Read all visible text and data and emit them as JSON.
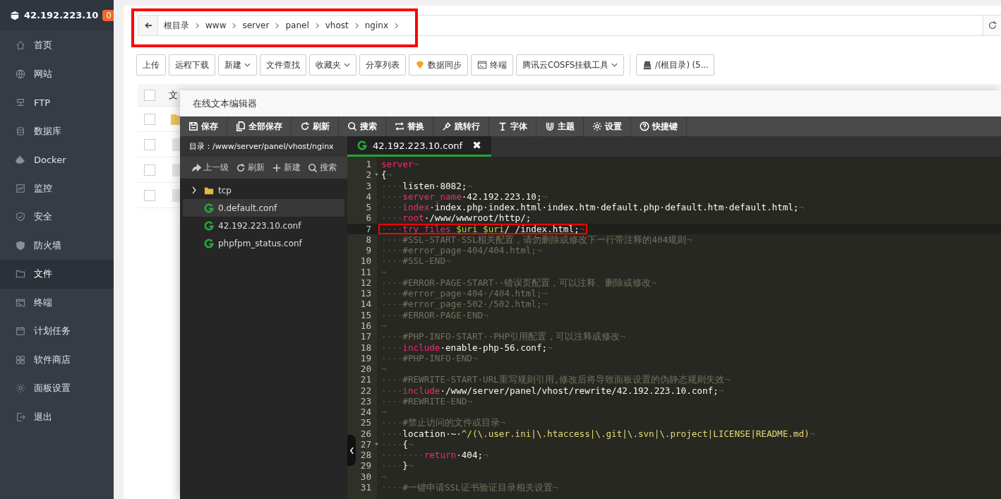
{
  "sidebar": {
    "server": "42.192.223.10",
    "badge": "0",
    "items": [
      {
        "label": "首页",
        "selected": false
      },
      {
        "label": "网站",
        "selected": false
      },
      {
        "label": "FTP",
        "selected": false
      },
      {
        "label": "数据库",
        "selected": false
      },
      {
        "label": "Docker",
        "selected": false
      },
      {
        "label": "监控",
        "selected": false
      },
      {
        "label": "安全",
        "selected": false
      },
      {
        "label": "防火墙",
        "selected": false
      },
      {
        "label": "文件",
        "selected": true
      },
      {
        "label": "终端",
        "selected": false
      },
      {
        "label": "计划任务",
        "selected": false
      },
      {
        "label": "软件商店",
        "selected": false
      },
      {
        "label": "面板设置",
        "selected": false
      },
      {
        "label": "退出",
        "selected": false
      }
    ]
  },
  "breadcrumb": {
    "highlighted": true,
    "items": [
      "根目录",
      "www",
      "server",
      "panel",
      "vhost",
      "nginx"
    ]
  },
  "toolbar": [
    {
      "label": "上传",
      "kind": "plain"
    },
    {
      "label": "远程下载",
      "kind": "plain"
    },
    {
      "label": "新建",
      "kind": "dropdown"
    },
    {
      "label": "文件查找",
      "kind": "plain"
    },
    {
      "label": "收藏夹",
      "kind": "dropdown"
    },
    {
      "label": "分享列表",
      "kind": "plain"
    },
    {
      "label": "数据同步",
      "kind": "gem"
    },
    {
      "label": "终端",
      "kind": "terminal"
    },
    {
      "label": "腾讯云COSFS挂载工具",
      "kind": "dropdown"
    },
    {
      "label": "/(根目录) (5...",
      "kind": "disk"
    }
  ],
  "file_table": {
    "header_checkbox": {
      "checked": false
    },
    "column_1": "文",
    "rows": [
      {
        "kind": "folder",
        "checked": false
      },
      {
        "kind": "file",
        "checked": false
      },
      {
        "kind": "file",
        "checked": false
      },
      {
        "kind": "file",
        "checked": false
      }
    ]
  },
  "editor": {
    "title": "在线文本编辑器",
    "toolbar": [
      "保存",
      "全部保存",
      "刷新",
      "搜索",
      "替换",
      "跳转行",
      "字体",
      "主题",
      "设置",
      "快捷键"
    ],
    "directory": "目录：/www/server/panel/vhost/nginx",
    "actions": [
      "上一级",
      "刷新",
      "新建",
      "搜索"
    ],
    "tree": [
      {
        "name": "tcp",
        "kind": "folder",
        "selected": false
      },
      {
        "name": "0.default.conf",
        "kind": "file",
        "selected": true
      },
      {
        "name": "42.192.223.10.conf",
        "kind": "file",
        "selected": false
      },
      {
        "name": "phpfpm_status.conf",
        "kind": "file",
        "selected": false
      }
    ],
    "tabs": [
      {
        "label": "42.192.223.10.conf",
        "close": "✖",
        "selected": true
      }
    ],
    "lines": [
      {
        "n": "1",
        "fold": false,
        "marked": false,
        "tokens": [
          {
            "kind": "keyword",
            "text": "server"
          },
          {
            "kind": "whitespace",
            "text": "¬"
          }
        ]
      },
      {
        "n": "2",
        "fold": true,
        "marked": false,
        "tokens": [
          {
            "kind": "plain",
            "text": "{"
          },
          {
            "kind": "whitespace",
            "text": "¬"
          }
        ]
      },
      {
        "n": "3",
        "fold": false,
        "marked": false,
        "tokens": [
          {
            "kind": "whitespace",
            "text": "····"
          },
          {
            "kind": "plain",
            "text": "listen·8082;"
          },
          {
            "kind": "whitespace",
            "text": "¬"
          }
        ]
      },
      {
        "n": "4",
        "fold": false,
        "marked": false,
        "tokens": [
          {
            "kind": "whitespace",
            "text": "····"
          },
          {
            "kind": "keyword",
            "text": "server_name"
          },
          {
            "kind": "plain",
            "text": "·42.192.223.10;"
          },
          {
            "kind": "whitespace",
            "text": "¬"
          }
        ]
      },
      {
        "n": "5",
        "fold": false,
        "marked": false,
        "tokens": [
          {
            "kind": "whitespace",
            "text": "····"
          },
          {
            "kind": "keyword",
            "text": "index"
          },
          {
            "kind": "plain",
            "text": "·index.php·index.html·index.htm·default.php·default.htm·default.html;"
          },
          {
            "kind": "whitespace",
            "text": "¬"
          }
        ]
      },
      {
        "n": "6",
        "fold": false,
        "marked": false,
        "tokens": [
          {
            "kind": "whitespace",
            "text": "····"
          },
          {
            "kind": "keyword",
            "text": "root"
          },
          {
            "kind": "plain",
            "text": "·/www/wwwroot/http/;"
          }
        ]
      },
      {
        "n": "7",
        "fold": false,
        "marked": true,
        "tokens": [
          {
            "kind": "whitespace",
            "text": "····"
          },
          {
            "kind": "keyword",
            "text": "try_files"
          },
          {
            "kind": "variable",
            "text": " $uri $uri"
          },
          {
            "kind": "plain",
            "text": "/ /index.html;"
          },
          {
            "kind": "whitespace",
            "text": "¬"
          }
        ]
      },
      {
        "n": "8",
        "fold": false,
        "marked": false,
        "tokens": [
          {
            "kind": "whitespace",
            "text": "····"
          },
          {
            "kind": "comment",
            "text": "#SSL-START·SSL相关配置，请勿删除或修改下一行带注释的404规则"
          },
          {
            "kind": "whitespace",
            "text": "¬"
          }
        ]
      },
      {
        "n": "9",
        "fold": false,
        "marked": false,
        "tokens": [
          {
            "kind": "whitespace",
            "text": "····"
          },
          {
            "kind": "comment",
            "text": "#error_page·404/404.html;"
          },
          {
            "kind": "whitespace",
            "text": "¬"
          }
        ]
      },
      {
        "n": "10",
        "fold": false,
        "marked": false,
        "tokens": [
          {
            "kind": "whitespace",
            "text": "····"
          },
          {
            "kind": "comment",
            "text": "#SSL-END"
          },
          {
            "kind": "whitespace",
            "text": "¬"
          }
        ]
      },
      {
        "n": "11",
        "fold": false,
        "marked": false,
        "tokens": [
          {
            "kind": "whitespace",
            "text": "¬"
          }
        ]
      },
      {
        "n": "12",
        "fold": false,
        "marked": false,
        "tokens": [
          {
            "kind": "whitespace",
            "text": "····"
          },
          {
            "kind": "comment",
            "text": "#ERROR-PAGE-START··错误页配置，可以注释、删除或修改"
          },
          {
            "kind": "whitespace",
            "text": "¬"
          }
        ]
      },
      {
        "n": "13",
        "fold": false,
        "marked": false,
        "tokens": [
          {
            "kind": "whitespace",
            "text": "····"
          },
          {
            "kind": "comment",
            "text": "#error_page·404·/404.html;"
          },
          {
            "kind": "whitespace",
            "text": "¬"
          }
        ]
      },
      {
        "n": "14",
        "fold": false,
        "marked": false,
        "tokens": [
          {
            "kind": "whitespace",
            "text": "····"
          },
          {
            "kind": "comment",
            "text": "#error_page·502·/502.html;"
          },
          {
            "kind": "whitespace",
            "text": "¬"
          }
        ]
      },
      {
        "n": "15",
        "fold": false,
        "marked": false,
        "tokens": [
          {
            "kind": "whitespace",
            "text": "····"
          },
          {
            "kind": "comment",
            "text": "#ERROR-PAGE-END"
          },
          {
            "kind": "whitespace",
            "text": "¬"
          }
        ]
      },
      {
        "n": "16",
        "fold": false,
        "marked": false,
        "tokens": [
          {
            "kind": "whitespace",
            "text": "¬"
          }
        ]
      },
      {
        "n": "17",
        "fold": false,
        "marked": false,
        "tokens": [
          {
            "kind": "whitespace",
            "text": "····"
          },
          {
            "kind": "comment",
            "text": "#PHP-INFO-START··PHP引用配置，可以注释或修改"
          },
          {
            "kind": "whitespace",
            "text": "¬"
          }
        ]
      },
      {
        "n": "18",
        "fold": false,
        "marked": false,
        "tokens": [
          {
            "kind": "whitespace",
            "text": "····"
          },
          {
            "kind": "keyword",
            "text": "include"
          },
          {
            "kind": "plain",
            "text": "·enable-php-56.conf;"
          },
          {
            "kind": "whitespace",
            "text": "¬"
          }
        ]
      },
      {
        "n": "19",
        "fold": false,
        "marked": false,
        "tokens": [
          {
            "kind": "whitespace",
            "text": "····"
          },
          {
            "kind": "comment",
            "text": "#PHP-INFO-END"
          },
          {
            "kind": "whitespace",
            "text": "¬"
          }
        ]
      },
      {
        "n": "20",
        "fold": false,
        "marked": false,
        "tokens": [
          {
            "kind": "whitespace",
            "text": "¬"
          }
        ]
      },
      {
        "n": "21",
        "fold": false,
        "marked": false,
        "tokens": [
          {
            "kind": "whitespace",
            "text": "····"
          },
          {
            "kind": "comment",
            "text": "#REWRITE-START·URL重写规则引用,修改后将导致面板设置的伪静态规则失效"
          },
          {
            "kind": "whitespace",
            "text": "¬"
          }
        ]
      },
      {
        "n": "22",
        "fold": false,
        "marked": false,
        "tokens": [
          {
            "kind": "whitespace",
            "text": "····"
          },
          {
            "kind": "keyword",
            "text": "include"
          },
          {
            "kind": "plain",
            "text": "·/www/server/panel/vhost/rewrite/42.192.223.10.conf;"
          },
          {
            "kind": "whitespace",
            "text": "¬"
          }
        ]
      },
      {
        "n": "23",
        "fold": false,
        "marked": false,
        "tokens": [
          {
            "kind": "whitespace",
            "text": "····"
          },
          {
            "kind": "comment",
            "text": "#REWRITE-END"
          },
          {
            "kind": "whitespace",
            "text": "¬"
          }
        ]
      },
      {
        "n": "24",
        "fold": false,
        "marked": false,
        "tokens": [
          {
            "kind": "whitespace",
            "text": "¬"
          }
        ]
      },
      {
        "n": "25",
        "fold": false,
        "marked": false,
        "tokens": [
          {
            "kind": "whitespace",
            "text": "····"
          },
          {
            "kind": "comment",
            "text": "#禁止访问的文件或目录"
          },
          {
            "kind": "whitespace",
            "text": "¬"
          }
        ]
      },
      {
        "n": "26",
        "fold": false,
        "marked": false,
        "tokens": [
          {
            "kind": "whitespace",
            "text": "····"
          },
          {
            "kind": "plain",
            "text": "location·~·"
          },
          {
            "kind": "string",
            "text": "^/(\\.user.ini|\\.htaccess|\\.git|\\.svn|\\.project|LICENSE|README.md)"
          },
          {
            "kind": "whitespace",
            "text": "¬"
          }
        ]
      },
      {
        "n": "27",
        "fold": true,
        "marked": false,
        "tokens": [
          {
            "kind": "whitespace",
            "text": "····"
          },
          {
            "kind": "plain",
            "text": "{"
          },
          {
            "kind": "whitespace",
            "text": "¬"
          }
        ]
      },
      {
        "n": "28",
        "fold": false,
        "marked": false,
        "tokens": [
          {
            "kind": "whitespace",
            "text": "········"
          },
          {
            "kind": "keyword",
            "text": "return"
          },
          {
            "kind": "plain",
            "text": "·404;"
          },
          {
            "kind": "whitespace",
            "text": "¬"
          }
        ]
      },
      {
        "n": "29",
        "fold": false,
        "marked": false,
        "tokens": [
          {
            "kind": "whitespace",
            "text": "····"
          },
          {
            "kind": "plain",
            "text": "}"
          },
          {
            "kind": "whitespace",
            "text": "¬"
          }
        ]
      },
      {
        "n": "30",
        "fold": false,
        "marked": false,
        "tokens": [
          {
            "kind": "whitespace",
            "text": "¬"
          }
        ]
      },
      {
        "n": "31",
        "fold": false,
        "marked": false,
        "tokens": [
          {
            "kind": "whitespace",
            "text": "····"
          },
          {
            "kind": "comment",
            "text": "#一键申请SSL证书验证目录相关设置"
          },
          {
            "kind": "whitespace",
            "text": "¬"
          }
        ]
      }
    ]
  }
}
